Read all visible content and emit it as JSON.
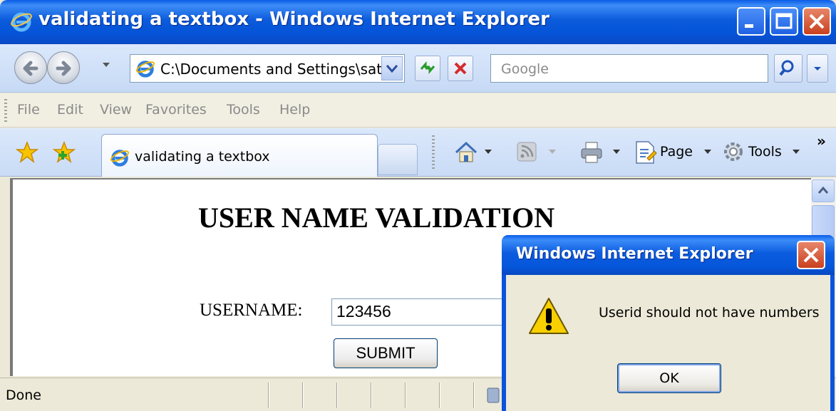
{
  "window": {
    "title": "validating a textbox - Windows Internet Explorer",
    "icon": "ie-logo-icon"
  },
  "navbar": {
    "address": "C:\\Documents and Settings\\sati:",
    "search_placeholder": "Google"
  },
  "menubar": {
    "items": [
      "File",
      "Edit",
      "View",
      "Favorites",
      "Tools",
      "Help"
    ]
  },
  "tabbar": {
    "tab_label": "validating a textbox",
    "page_label": "Page",
    "tools_label": "Tools",
    "overflow": "»"
  },
  "page": {
    "heading": "USER NAME VALIDATION",
    "username_label": "USERNAME:",
    "username_value": "123456",
    "submit_label": "SUBMIT"
  },
  "statusbar": {
    "text": "Done"
  },
  "dialog": {
    "title": "Windows Internet Explorer",
    "message": "Userid should not have numbers",
    "ok_label": "OK",
    "icon": "warning-icon"
  },
  "colors": {
    "titlebar": "#0b5bdc",
    "dialog_body": "#ece9d8",
    "close_button": "#c9401f"
  }
}
